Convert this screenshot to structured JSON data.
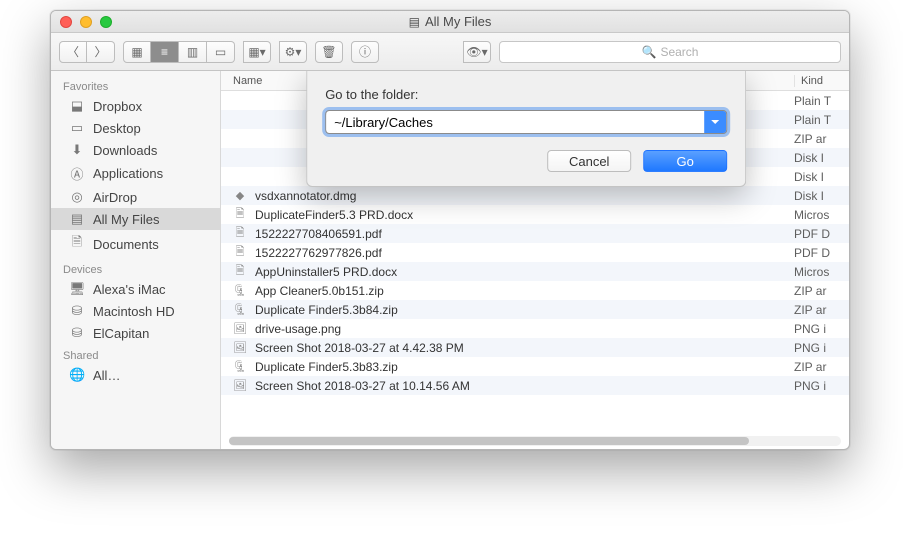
{
  "titlebar": {
    "title": "All My Files"
  },
  "toolbar": {
    "search_placeholder": "Search"
  },
  "sidebar": {
    "sections": [
      {
        "header": "Favorites",
        "items": [
          {
            "icon": "dropbox",
            "label": "Dropbox"
          },
          {
            "icon": "desktop",
            "label": "Desktop"
          },
          {
            "icon": "downloads",
            "label": "Downloads"
          },
          {
            "icon": "apps",
            "label": "Applications"
          },
          {
            "icon": "airdrop",
            "label": "AirDrop"
          },
          {
            "icon": "allfiles",
            "label": "All My Files",
            "active": true
          },
          {
            "icon": "documents",
            "label": "Documents"
          }
        ]
      },
      {
        "header": "Devices",
        "items": [
          {
            "icon": "imac",
            "label": "Alexa's iMac"
          },
          {
            "icon": "hdd",
            "label": "Macintosh HD"
          },
          {
            "icon": "hdd",
            "label": "ElCapitan"
          }
        ]
      },
      {
        "header": "Shared",
        "items": [
          {
            "icon": "globe",
            "label": "All…"
          }
        ]
      }
    ]
  },
  "columns": {
    "name": "Name",
    "kind": "Kind"
  },
  "files": [
    {
      "icon": "blank",
      "name": "",
      "kind": "Plain T"
    },
    {
      "icon": "blank",
      "name": "",
      "kind": "Plain T"
    },
    {
      "icon": "blank",
      "name": "",
      "kind": "ZIP ar"
    },
    {
      "icon": "blank",
      "name": "",
      "kind": "Disk I"
    },
    {
      "icon": "blank",
      "name": "",
      "kind": "Disk I"
    },
    {
      "icon": "dmg",
      "name": "vsdxannotator.dmg",
      "kind": "Disk I"
    },
    {
      "icon": "doc",
      "name": "DuplicateFinder5.3 PRD.docx",
      "kind": "Micros"
    },
    {
      "icon": "pdf",
      "name": "1522227708406591.pdf",
      "kind": "PDF D"
    },
    {
      "icon": "pdf",
      "name": "1522227762977826.pdf",
      "kind": "PDF D"
    },
    {
      "icon": "doc",
      "name": "AppUninstaller5 PRD.docx",
      "kind": "Micros"
    },
    {
      "icon": "zip",
      "name": "App Cleaner5.0b151.zip",
      "kind": "ZIP ar"
    },
    {
      "icon": "zip",
      "name": "Duplicate Finder5.3b84.zip",
      "kind": "ZIP ar"
    },
    {
      "icon": "png",
      "name": "drive-usage.png",
      "kind": "PNG i"
    },
    {
      "icon": "png",
      "name": "Screen Shot 2018-03-27 at 4.42.38 PM",
      "kind": "PNG i"
    },
    {
      "icon": "zip",
      "name": "Duplicate Finder5.3b83.zip",
      "kind": "ZIP ar"
    },
    {
      "icon": "png",
      "name": "Screen Shot 2018-03-27 at 10.14.56 AM",
      "kind": "PNG i"
    }
  ],
  "dialog": {
    "label": "Go to the folder:",
    "value": "~/Library/Caches",
    "cancel": "Cancel",
    "go": "Go"
  },
  "icon_glyphs": {
    "dropbox": "⬓",
    "desktop": "▭",
    "downloads": "⬇",
    "apps": "Ⓐ",
    "airdrop": "◎",
    "allfiles": "▤",
    "documents": "🗎",
    "imac": "🖥",
    "hdd": "⛁",
    "globe": "🌐",
    "blank": "",
    "dmg": "◆",
    "doc": "🗎",
    "pdf": "🗎",
    "zip": "🗜",
    "png": "🖼"
  }
}
